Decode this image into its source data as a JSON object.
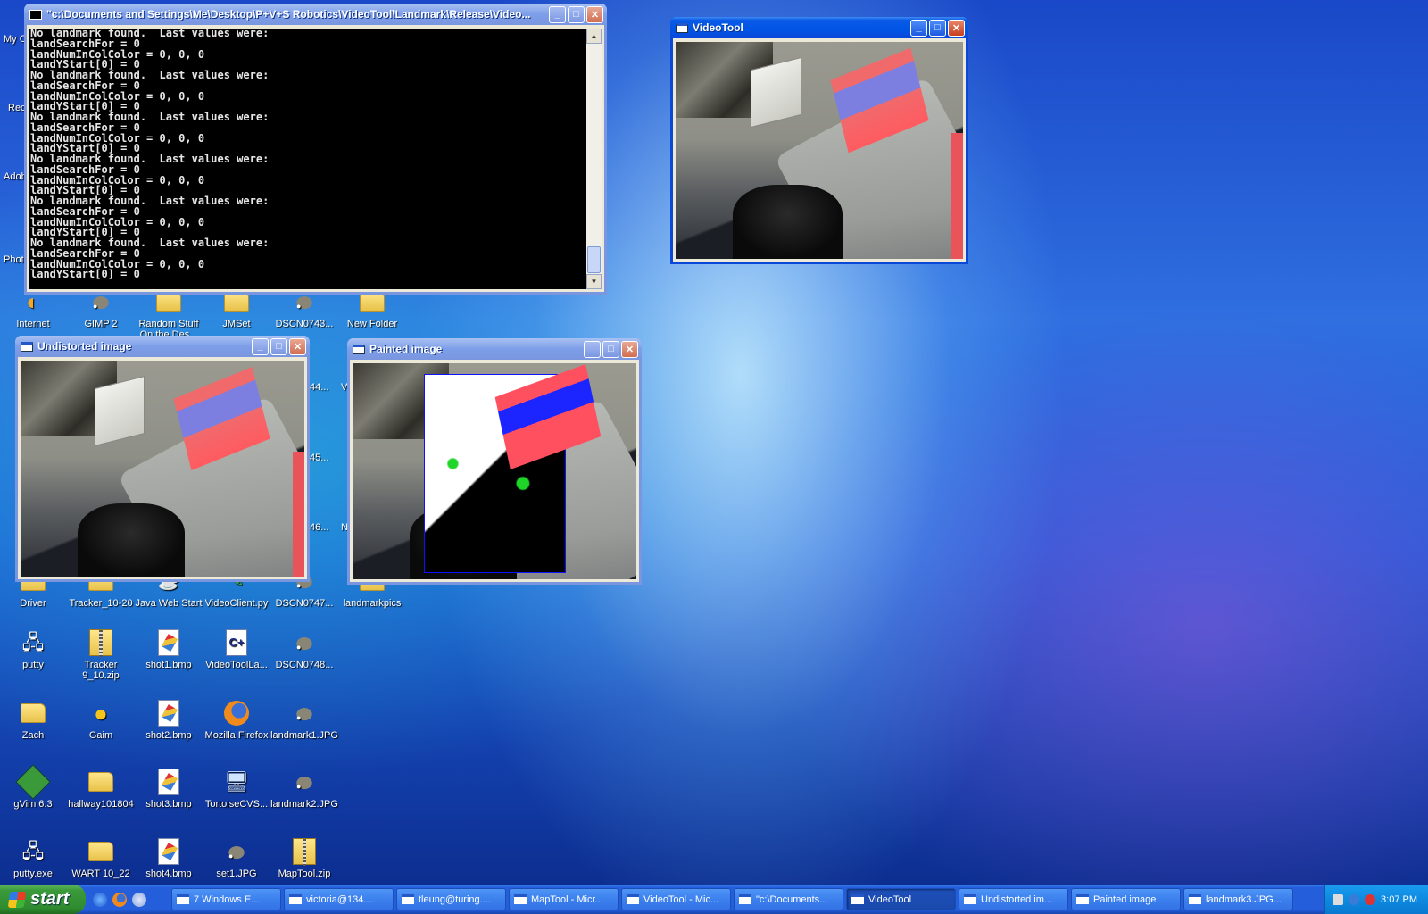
{
  "console": {
    "title": "\"c:\\Documents and Settings\\Me\\Desktop\\P+V+S Robotics\\VideoTool\\Landmark\\Release\\Video...",
    "lines": [
      "No landmark found.  Last values were:",
      "landSearchFor = 0",
      "landNumInColColor = 0, 0, 0",
      "landYStart[0] = 0",
      "No landmark found.  Last values were:",
      "landSearchFor = 0",
      "landNumInColColor = 0, 0, 0",
      "landYStart[0] = 0",
      "No landmark found.  Last values were:",
      "landSearchFor = 0",
      "landNumInColColor = 0, 0, 0",
      "landYStart[0] = 0",
      "No landmark found.  Last values were:",
      "landSearchFor = 0",
      "landNumInColColor = 0, 0, 0",
      "landYStart[0] = 0",
      "No landmark found.  Last values were:",
      "landSearchFor = 0",
      "landNumInColColor = 0, 0, 0",
      "landYStart[0] = 0",
      "No landmark found.  Last values were:",
      "landSearchFor = 0",
      "landNumInColColor = 0, 0, 0",
      "landYStart[0] = 0"
    ]
  },
  "windows": {
    "videotool": {
      "title": "VideoTool"
    },
    "undistorted": {
      "title": "Undistorted image"
    },
    "painted": {
      "title": "Painted image"
    }
  },
  "window_buttons": {
    "minimize": "_",
    "maximize": "□",
    "close": "✕"
  },
  "desktop_icons": {
    "row1": [
      "Internet",
      "GIMP 2",
      "Random Stuff On the Des...",
      "JMSet",
      "DSCN0743...",
      "New Folder"
    ],
    "row2": [
      "Driver",
      "Tracker_10-20",
      "Java Web Start",
      "VideoClient.py",
      "DSCN0747...",
      "landmarkpics"
    ],
    "row3": [
      "putty",
      "Tracker 9_10.zip",
      "shot1.bmp",
      "VideoToolLa...",
      "DSCN0748..."
    ],
    "row4": [
      "Zach",
      "Gaim",
      "shot2.bmp",
      "Mozilla Firefox",
      "landmark1.JPG"
    ],
    "row5": [
      "gVim 6.3",
      "hallway101804",
      "shot3.bmp",
      "TortoiseCVS...",
      "landmark2.JPG"
    ],
    "row6": [
      "putty.exe",
      "WART 10_22",
      "shot4.bmp",
      "set1.JPG",
      "MapTool.zip"
    ]
  },
  "partial_labels": {
    "left": [
      "My C",
      "Rec",
      "Adob",
      "Phot"
    ],
    "mid": [
      "44...",
      "45...",
      "46..."
    ],
    "mid_right": [
      "V",
      "N"
    ]
  },
  "taskbar": {
    "start_label": "start",
    "tasks": [
      "7 Windows E...",
      "victoria@134....",
      "tleung@turing....",
      "MapTool - Micr...",
      "VideoTool - Mic...",
      "\"c:\\Documents...",
      "VideoTool",
      "Undistorted im...",
      "Painted image",
      "landmark3.JPG..."
    ],
    "clock": "3:07 PM"
  },
  "colors": {
    "xp_blue_titlebar": "#0a5ae6",
    "console_bg": "#000000",
    "landmark_red": "#f06a6c",
    "landmark_blue": "#7c7fe0"
  }
}
